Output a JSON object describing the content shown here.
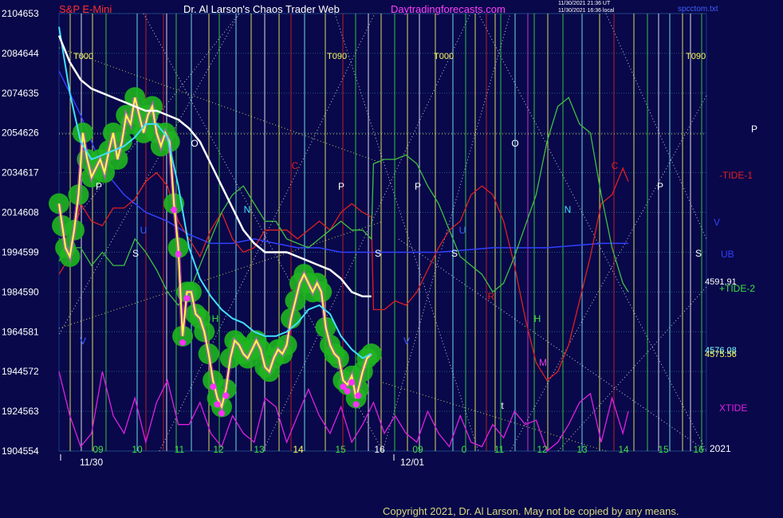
{
  "header": {
    "symbol": "S&P E-Mini",
    "title": "Dr. Al Larson's Chaos Trader Web",
    "site": "Daytradingforecasts.com",
    "timestamp_1": "11/30/2021 21:36 UT",
    "timestamp_2": "11/30/2021 16:36 local",
    "file": "spcctom.txt"
  },
  "copyright": "Copyright 2021, Dr. Al Larson. May not be copied by any means.",
  "colors": {
    "background": "#08084a",
    "grid": "#2a5a7a",
    "price_yellow": "#ffff40",
    "price_green_glow": "#1fb51f",
    "fast_ma": "#40e0ff",
    "slow_ma": "#ffffff",
    "tide1": "#e02020",
    "tide2": "#40c040",
    "xtide": "#e020e0",
    "ub": "#3040ff",
    "pink_marks": "#ff30ff"
  },
  "chart_data": {
    "type": "line",
    "title": "S&P E-Mini",
    "y_left_labels": [
      "210",
      "208",
      "207",
      "205",
      "203",
      "201",
      "199",
      "198",
      "196",
      "194",
      "192",
      "190"
    ],
    "y_right_labels": [
      "4653",
      "4644",
      "4635",
      "4626",
      "4617",
      "4608",
      "4599",
      "4590",
      "4581",
      "4572",
      "4563",
      "4554"
    ],
    "ylim": [
      4554,
      4653
    ],
    "x_time_labels": [
      "09",
      "10",
      "11",
      "12",
      "13",
      "14",
      "15",
      "16",
      "09",
      "0",
      "11",
      "12",
      "13",
      "14",
      "15",
      "16"
    ],
    "x_date_labels": [
      "11/30",
      "12/01"
    ],
    "x_year_label": "2021",
    "top_markers": [
      "T000",
      "T090",
      "T000",
      "T090"
    ],
    "series_labels": [
      "-TIDE-1",
      "+TIDE-2",
      "XTIDE",
      "UB",
      "V"
    ],
    "price_readouts": [
      "4591.91",
      "4576.08",
      "4575.56"
    ],
    "planet_letters": [
      "P",
      "O",
      "C",
      "P",
      "P",
      "O",
      "C",
      "P",
      "N",
      "N",
      "U",
      "U",
      "S",
      "S",
      "S",
      "S",
      "H",
      "H",
      "R",
      "M",
      "V",
      "V",
      "t",
      "P"
    ],
    "price_path": [
      [
        0,
        4610
      ],
      [
        0.03,
        4605
      ],
      [
        0.06,
        4600
      ],
      [
        0.1,
        4598
      ],
      [
        0.14,
        4604
      ],
      [
        0.18,
        4612
      ],
      [
        0.22,
        4626
      ],
      [
        0.26,
        4620
      ],
      [
        0.3,
        4616
      ],
      [
        0.34,
        4618
      ],
      [
        0.38,
        4620
      ],
      [
        0.42,
        4617
      ],
      [
        0.46,
        4622
      ],
      [
        0.5,
        4626
      ],
      [
        0.54,
        4620
      ],
      [
        0.58,
        4624
      ],
      [
        0.62,
        4630
      ],
      [
        0.66,
        4628
      ],
      [
        0.7,
        4634
      ],
      [
        0.74,
        4630
      ],
      [
        0.78,
        4626
      ],
      [
        0.82,
        4630
      ],
      [
        0.86,
        4632
      ],
      [
        0.9,
        4626
      ],
      [
        0.94,
        4623
      ],
      [
        0.98,
        4626
      ],
      [
        1.02,
        4624
      ],
      [
        1.06,
        4610
      ],
      [
        1.1,
        4600
      ],
      [
        1.14,
        4580
      ],
      [
        1.18,
        4590
      ],
      [
        1.22,
        4590
      ],
      [
        1.26,
        4585
      ],
      [
        1.3,
        4584
      ],
      [
        1.34,
        4581
      ],
      [
        1.38,
        4576
      ],
      [
        1.42,
        4570
      ],
      [
        1.46,
        4566
      ],
      [
        1.5,
        4564
      ],
      [
        1.54,
        4568
      ],
      [
        1.58,
        4575
      ],
      [
        1.62,
        4579
      ],
      [
        1.66,
        4578
      ],
      [
        1.7,
        4576
      ],
      [
        1.74,
        4575
      ],
      [
        1.78,
        4577
      ],
      [
        1.82,
        4579
      ],
      [
        1.86,
        4577
      ],
      [
        1.9,
        4573
      ],
      [
        1.94,
        4572
      ],
      [
        1.98,
        4575
      ],
      [
        2.02,
        4577
      ],
      [
        2.06,
        4576
      ],
      [
        2.1,
        4578
      ],
      [
        2.14,
        4584
      ],
      [
        2.18,
        4588
      ],
      [
        2.22,
        4592
      ],
      [
        2.26,
        4594
      ],
      [
        2.3,
        4592
      ],
      [
        2.34,
        4590
      ],
      [
        2.38,
        4592
      ],
      [
        2.42,
        4590
      ],
      [
        2.46,
        4582
      ],
      [
        2.5,
        4578
      ],
      [
        2.54,
        4576
      ],
      [
        2.58,
        4575
      ],
      [
        2.62,
        4570
      ],
      [
        2.66,
        4569
      ],
      [
        2.7,
        4571
      ],
      [
        2.74,
        4566
      ],
      [
        2.76,
        4568
      ],
      [
        2.8,
        4572
      ],
      [
        2.84,
        4575
      ],
      [
        2.88,
        4576
      ]
    ],
    "fast_ma_path": [
      [
        0,
        4650
      ],
      [
        0.1,
        4635
      ],
      [
        0.2,
        4624
      ],
      [
        0.3,
        4620
      ],
      [
        0.4,
        4621
      ],
      [
        0.5,
        4622
      ],
      [
        0.6,
        4623
      ],
      [
        0.7,
        4625
      ],
      [
        0.8,
        4628
      ],
      [
        0.9,
        4628
      ],
      [
        1.0,
        4625
      ],
      [
        1.1,
        4614
      ],
      [
        1.2,
        4600
      ],
      [
        1.3,
        4593
      ],
      [
        1.4,
        4589
      ],
      [
        1.5,
        4586
      ],
      [
        1.6,
        4584
      ],
      [
        1.7,
        4583
      ],
      [
        1.8,
        4581
      ],
      [
        1.9,
        4580
      ],
      [
        2.0,
        4580
      ],
      [
        2.1,
        4581
      ],
      [
        2.2,
        4583
      ],
      [
        2.3,
        4586
      ],
      [
        2.4,
        4587
      ],
      [
        2.5,
        4585
      ],
      [
        2.6,
        4580
      ],
      [
        2.7,
        4577
      ],
      [
        2.8,
        4575
      ],
      [
        2.88,
        4576
      ]
    ],
    "slow_ma_path": [
      [
        0,
        4648
      ],
      [
        0.1,
        4642
      ],
      [
        0.2,
        4638
      ],
      [
        0.3,
        4636
      ],
      [
        0.4,
        4635
      ],
      [
        0.5,
        4634
      ],
      [
        0.6,
        4633
      ],
      [
        0.7,
        4632
      ],
      [
        0.8,
        4631
      ],
      [
        0.9,
        4631
      ],
      [
        1.0,
        4630
      ],
      [
        1.1,
        4629
      ],
      [
        1.2,
        4627
      ],
      [
        1.3,
        4624
      ],
      [
        1.4,
        4619
      ],
      [
        1.5,
        4614
      ],
      [
        1.6,
        4609
      ],
      [
        1.7,
        4604
      ],
      [
        1.8,
        4601
      ],
      [
        1.9,
        4599
      ],
      [
        2.0,
        4599
      ],
      [
        2.1,
        4599
      ],
      [
        2.2,
        4598
      ],
      [
        2.3,
        4597
      ],
      [
        2.4,
        4596
      ],
      [
        2.5,
        4595
      ],
      [
        2.6,
        4593
      ],
      [
        2.7,
        4590
      ],
      [
        2.8,
        4589
      ],
      [
        2.88,
        4589
      ]
    ],
    "tide1_path": [
      [
        0,
        4594
      ],
      [
        0.1,
        4598
      ],
      [
        0.2,
        4610
      ],
      [
        0.3,
        4606
      ],
      [
        0.4,
        4605
      ],
      [
        0.5,
        4609
      ],
      [
        0.6,
        4609
      ],
      [
        0.7,
        4611
      ],
      [
        0.8,
        4615
      ],
      [
        0.9,
        4617
      ],
      [
        1.0,
        4614
      ],
      [
        1.1,
        4606
      ],
      [
        1.2,
        4602
      ],
      [
        1.3,
        4598
      ],
      [
        1.4,
        4604
      ],
      [
        1.5,
        4608
      ],
      [
        1.6,
        4602
      ],
      [
        1.7,
        4599
      ],
      [
        1.8,
        4600
      ],
      [
        1.9,
        4604
      ],
      [
        2.0,
        4604
      ],
      [
        2.1,
        4604
      ],
      [
        2.2,
        4602
      ],
      [
        2.3,
        4604
      ],
      [
        2.4,
        4606
      ],
      [
        2.5,
        4604
      ],
      [
        2.6,
        4608
      ],
      [
        2.7,
        4610
      ],
      [
        2.8,
        4608
      ],
      [
        2.88,
        4607
      ],
      [
        2.9,
        4586
      ],
      [
        3.0,
        4586
      ],
      [
        3.1,
        4588
      ],
      [
        3.2,
        4587
      ],
      [
        3.3,
        4590
      ],
      [
        3.4,
        4595
      ],
      [
        3.5,
        4600
      ],
      [
        3.6,
        4604
      ],
      [
        3.7,
        4606
      ],
      [
        3.8,
        4612
      ],
      [
        3.9,
        4614
      ],
      [
        4.0,
        4612
      ],
      [
        4.1,
        4606
      ],
      [
        4.2,
        4596
      ],
      [
        4.3,
        4584
      ],
      [
        4.4,
        4574
      ],
      [
        4.5,
        4570
      ],
      [
        4.6,
        4572
      ],
      [
        4.7,
        4578
      ],
      [
        4.8,
        4588
      ],
      [
        4.9,
        4598
      ],
      [
        5.0,
        4610
      ],
      [
        5.1,
        4612
      ],
      [
        5.2,
        4618
      ],
      [
        5.25,
        4615
      ]
    ],
    "tide2_path": [
      [
        0,
        4597
      ],
      [
        0.1,
        4600
      ],
      [
        0.2,
        4600
      ],
      [
        0.3,
        4596
      ],
      [
        0.4,
        4599
      ],
      [
        0.5,
        4596
      ],
      [
        0.6,
        4596
      ],
      [
        0.7,
        4602
      ],
      [
        0.8,
        4599
      ],
      [
        0.9,
        4595
      ],
      [
        1.0,
        4590
      ],
      [
        1.1,
        4587
      ],
      [
        1.2,
        4590
      ],
      [
        1.3,
        4596
      ],
      [
        1.4,
        4602
      ],
      [
        1.5,
        4608
      ],
      [
        1.6,
        4612
      ],
      [
        1.7,
        4614
      ],
      [
        1.8,
        4610
      ],
      [
        1.9,
        4606
      ],
      [
        2.0,
        4606
      ],
      [
        2.1,
        4602
      ],
      [
        2.2,
        4601
      ],
      [
        2.3,
        4600
      ],
      [
        2.4,
        4602
      ],
      [
        2.5,
        4604
      ],
      [
        2.6,
        4606
      ],
      [
        2.7,
        4604
      ],
      [
        2.8,
        4604
      ],
      [
        2.88,
        4602
      ],
      [
        2.9,
        4619
      ],
      [
        3.0,
        4620
      ],
      [
        3.1,
        4620
      ],
      [
        3.2,
        4621
      ],
      [
        3.3,
        4619
      ],
      [
        3.4,
        4614
      ],
      [
        3.5,
        4610
      ],
      [
        3.6,
        4604
      ],
      [
        3.7,
        4598
      ],
      [
        3.8,
        4596
      ],
      [
        3.9,
        4594
      ],
      [
        4.0,
        4590
      ],
      [
        4.1,
        4592
      ],
      [
        4.2,
        4598
      ],
      [
        4.3,
        4605
      ],
      [
        4.4,
        4612
      ],
      [
        4.5,
        4624
      ],
      [
        4.6,
        4632
      ],
      [
        4.7,
        4634
      ],
      [
        4.8,
        4628
      ],
      [
        4.9,
        4626
      ],
      [
        5.0,
        4612
      ],
      [
        5.1,
        4600
      ],
      [
        5.2,
        4592
      ],
      [
        5.25,
        4590
      ]
    ],
    "xtide_path": [
      [
        0,
        4572
      ],
      [
        0.1,
        4562
      ],
      [
        0.2,
        4555
      ],
      [
        0.3,
        4558
      ],
      [
        0.4,
        4572
      ],
      [
        0.5,
        4562
      ],
      [
        0.6,
        4558
      ],
      [
        0.7,
        4566
      ],
      [
        0.8,
        4556
      ],
      [
        0.9,
        4565
      ],
      [
        1.0,
        4570
      ],
      [
        1.1,
        4560
      ],
      [
        1.2,
        4560
      ],
      [
        1.3,
        4565
      ],
      [
        1.4,
        4558
      ],
      [
        1.5,
        4555
      ],
      [
        1.6,
        4562
      ],
      [
        1.7,
        4558
      ],
      [
        1.8,
        4556
      ],
      [
        1.9,
        4566
      ],
      [
        2.0,
        4564
      ],
      [
        2.1,
        4556
      ],
      [
        2.2,
        4562
      ],
      [
        2.3,
        4568
      ],
      [
        2.4,
        4562
      ],
      [
        2.5,
        4558
      ],
      [
        2.6,
        4564
      ],
      [
        2.7,
        4556
      ],
      [
        2.8,
        4560
      ],
      [
        2.9,
        4565
      ],
      [
        3.0,
        4558
      ],
      [
        3.1,
        4562
      ],
      [
        3.2,
        4558
      ],
      [
        3.3,
        4556
      ],
      [
        3.4,
        4563
      ],
      [
        3.5,
        4558
      ],
      [
        3.6,
        4555
      ],
      [
        3.7,
        4562
      ],
      [
        3.8,
        4556
      ],
      [
        3.9,
        4555
      ],
      [
        4.0,
        4560
      ],
      [
        4.1,
        4557
      ],
      [
        4.2,
        4563
      ],
      [
        4.3,
        4560
      ],
      [
        4.4,
        4561
      ],
      [
        4.5,
        4554
      ],
      [
        4.6,
        4556
      ],
      [
        4.7,
        4560
      ],
      [
        4.8,
        4565
      ],
      [
        4.9,
        4567
      ],
      [
        5.0,
        4556
      ],
      [
        5.1,
        4566
      ],
      [
        5.2,
        4558
      ],
      [
        5.25,
        4563
      ]
    ],
    "ub_path": [
      [
        0,
        4640
      ],
      [
        0.2,
        4630
      ],
      [
        0.4,
        4618
      ],
      [
        0.6,
        4612
      ],
      [
        0.8,
        4608
      ],
      [
        1.0,
        4606
      ],
      [
        1.2,
        4603
      ],
      [
        1.4,
        4601
      ],
      [
        1.6,
        4601
      ],
      [
        1.8,
        4602
      ],
      [
        2.0,
        4601
      ],
      [
        2.2,
        4600
      ],
      [
        2.4,
        4600
      ],
      [
        2.6,
        4599
      ],
      [
        2.8,
        4599
      ],
      [
        3.0,
        4599
      ],
      [
        3.5,
        4599
      ],
      [
        4.0,
        4600
      ],
      [
        4.5,
        4600
      ],
      [
        5.0,
        4601
      ],
      [
        5.25,
        4601
      ]
    ]
  }
}
